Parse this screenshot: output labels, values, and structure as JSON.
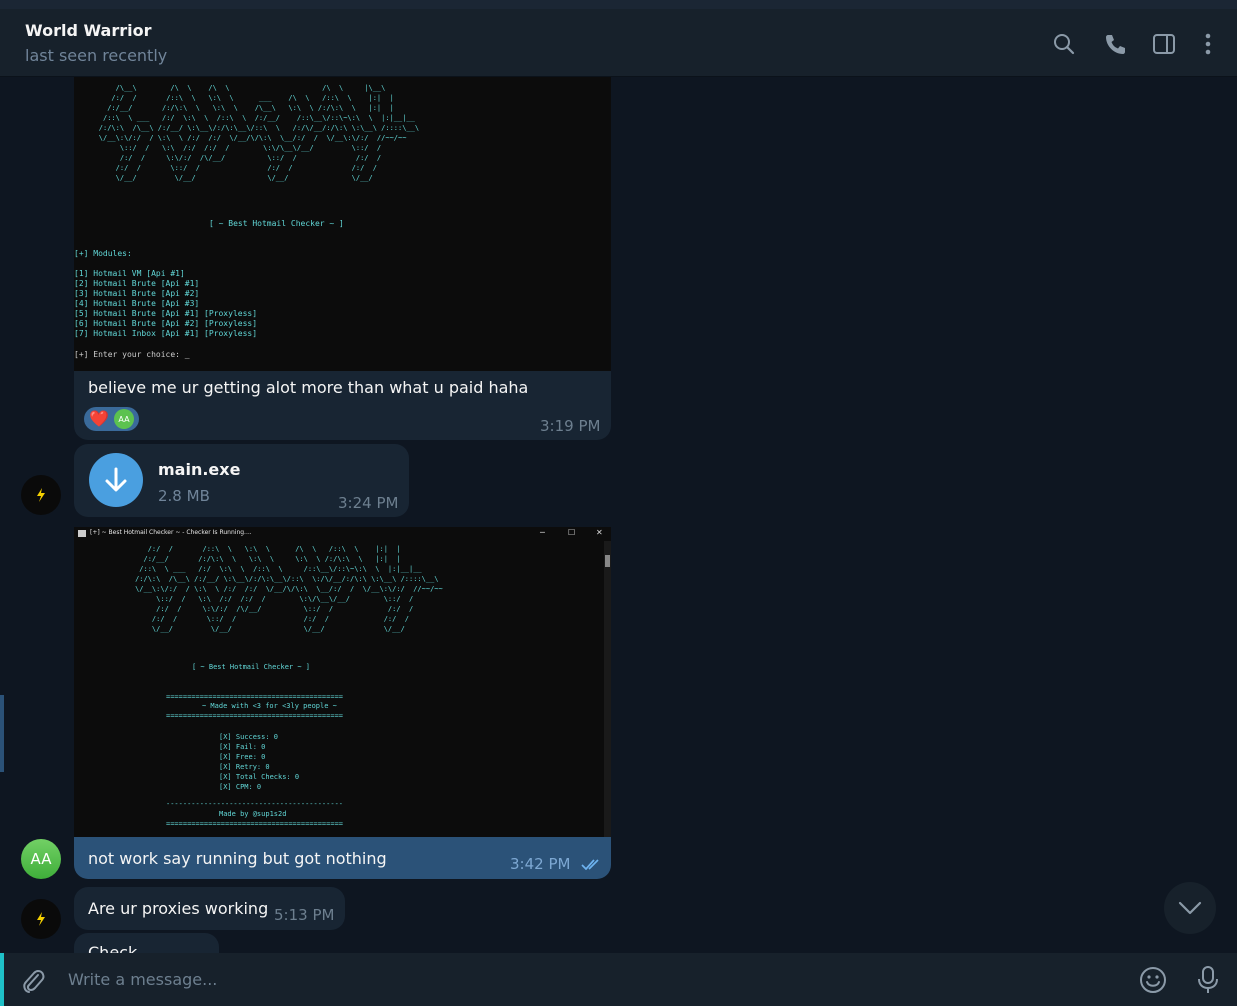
{
  "header": {
    "contact_name": "World Warrior",
    "status": "last seen recently",
    "icons": [
      "search-icon",
      "phone-icon",
      "sidebar-toggle-icon",
      "more-vertical-icon"
    ]
  },
  "messages": {
    "m1": {
      "terminal_ascii": "                 /\\__\\        /\\  \\    /\\  \\                      /\\  \\     |\\__\\\n                /:/  /       /::\\  \\   \\:\\  \\      ___    /\\  \\   /::\\  \\    |:|  |\n               /:/__/       /:/\\:\\  \\   \\:\\  \\    /\\__\\   \\:\\  \\ /:/\\:\\  \\   |:|  |\n              /::\\  \\ ___   /:/  \\:\\  \\  /::\\  \\  /:/__/    /::\\__\\/::\\~\\:\\  \\  |:|__|__\n             /:/\\:\\  /\\__\\ /:/__/ \\:\\__\\/:/\\:\\__\\/::\\  \\   /:/\\/__/:/\\:\\ \\:\\__\\ /::::\\__\\\n             \\/__\\:\\/:/  / \\:\\  \\ /:/  /:/  \\/__/\\/\\:\\  \\__/:/  /  \\/__\\:\\/:/  //~~/~~\n                  \\::/  /   \\:\\  /:/  /:/  /        \\:\\/\\__\\/__/         \\::/  /\n                  /:/  /     \\:\\/:/  /\\/__/          \\::/  /              /:/  /\n                 /:/  /       \\::/  /                /:/  /              /:/  /\n                 \\/__/         \\/__/                 \\/__/               \\/__/",
      "terminal_banner": "[ ~ Best Hotmail Checker ~ ]",
      "modules_header": "[+] Modules:",
      "modules": [
        "[1] Hotmail VM [Api #1]",
        "[2] Hotmail Brute [Api #1]",
        "[3] Hotmail Brute [Api #2]",
        "[4] Hotmail Brute [Api #3]",
        "[5] Hotmail Brute [Api #1] [Proxyless]",
        "[6] Hotmail Brute [Api #2] [Proxyless]",
        "[7] Hotmail Inbox [Api #1] [Proxyless]"
      ],
      "prompt": "[+] Enter your choice: ",
      "text": "believe me ur getting alot more than what u paid haha",
      "reaction_emoji": "❤️",
      "reaction_avatar": "AA",
      "time": "3:19 PM"
    },
    "m2": {
      "file_name": "main.exe",
      "file_size": "2.8 MB",
      "time": "3:24 PM"
    },
    "m3": {
      "window_title": "[+] ~ Best Hotmail Checker ~ - Checker Is Running....",
      "window_controls": [
        "─",
        "☐",
        "✕"
      ],
      "terminal_ascii": "        /:/  /       /::\\  \\   \\:\\  \\      /\\  \\   /::\\  \\    |:|  |\n       /:/__/       /:/\\:\\  \\   \\:\\  \\     \\:\\  \\ /:/\\:\\  \\   |:|  |\n      /::\\  \\ ___   /:/  \\:\\  \\  /::\\  \\     /::\\__\\/::\\~\\:\\  \\  |:|__|__\n     /:/\\:\\  /\\__\\ /:/__/ \\:\\__\\/:/\\:\\__\\/::\\  \\:/\\/__/:/\\:\\ \\:\\__\\ /::::\\__\\\n     \\/__\\:\\/:/  / \\:\\  \\ /:/  /:/  \\/__/\\/\\:\\  \\__/:/  /  \\/__\\:\\/:/  //~~/~~\n          \\::/  /   \\:\\  /:/  /:/  /        \\:\\/\\__\\/__/        \\::/  /\n          /:/  /     \\:\\/:/  /\\/__/          \\::/  /             /:/  /\n         /:/  /       \\::/  /                /:/  /             /:/  /\n         \\/__/         \\/__/                 \\/__/              \\/__/",
      "terminal_banner": "[ ~ Best Hotmail Checker ~ ]",
      "divider": "==========================================",
      "made_with": "~ Made with <3 for <3ly people ~",
      "stats": [
        "[X] Success: 0",
        "[X] Fail: 0",
        "[X] Free: 0",
        "[X] Retry: 0",
        "[X] Total Checks: 0",
        "[X] CPM: 0"
      ],
      "divider2": "------------------------------------------",
      "made_by": "Made by @sup1s2d",
      "text": "not work say running but got nothing",
      "time": "3:42 PM",
      "avatar": "AA"
    },
    "m4": {
      "text": "Are ur proxies working",
      "time": "5:13 PM"
    },
    "m5": {
      "text": "Check"
    }
  },
  "composer": {
    "placeholder": "Write a message..."
  },
  "colors": {
    "background": "#0e1621",
    "header": "#17212b",
    "incoming_bubble": "#182533",
    "outgoing_bubble": "#2b5278",
    "terminal_text": "#61d6d6",
    "accent": "#4a9fe0"
  }
}
